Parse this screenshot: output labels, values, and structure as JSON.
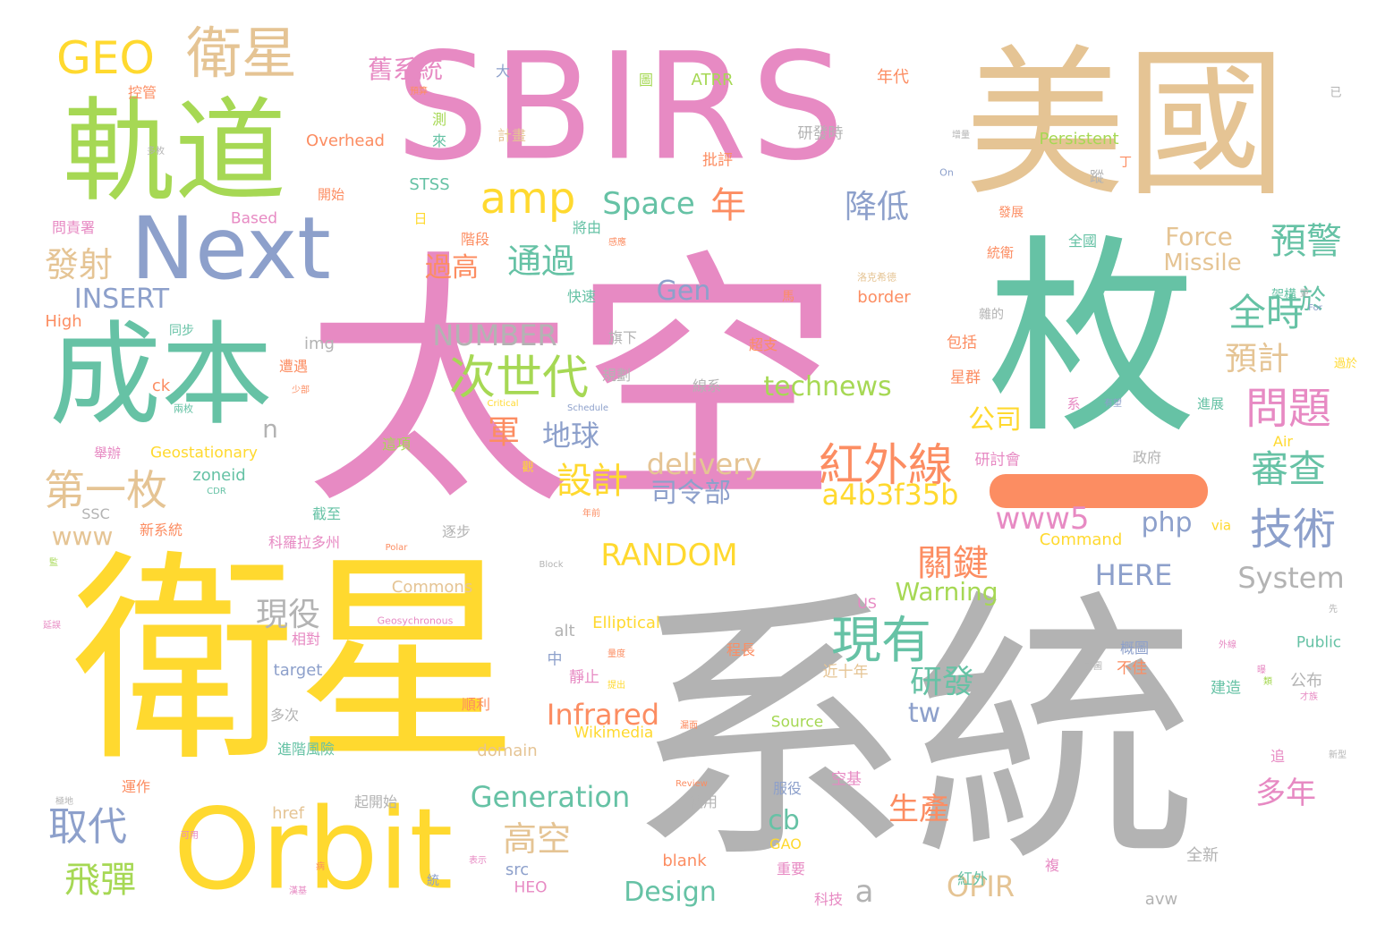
{
  "palette": {
    "pink": "#e78ac3",
    "grey": "#b3b3b3",
    "yellow": "#ffd92f",
    "green": "#a6d854",
    "teal": "#66c2a5",
    "tan": "#e5c494",
    "blue": "#8da0cb",
    "orange": "#fc8d62"
  },
  "words": [
    {
      "text": "太空",
      "color": "pink"
    },
    {
      "text": "系統",
      "color": "grey"
    },
    {
      "text": "衛星",
      "color": "yellow"
    },
    {
      "text": "SBIRS",
      "color": "pink"
    },
    {
      "text": "美國",
      "color": "tan"
    },
    {
      "text": "枚",
      "color": "teal"
    },
    {
      "text": "軌道",
      "color": "green"
    },
    {
      "text": "成本",
      "color": "teal"
    },
    {
      "text": "Orbit",
      "color": "yellow"
    },
    {
      "text": "Next",
      "color": "blue"
    },
    {
      "text": "衛星",
      "color": "tan"
    },
    {
      "text": "GEO",
      "color": "yellow"
    },
    {
      "text": "amp",
      "color": "yellow"
    },
    {
      "text": "現有",
      "color": "teal"
    },
    {
      "text": "紅外線",
      "color": "orange"
    },
    {
      "text": "次世代",
      "color": "green"
    },
    {
      "text": "技術",
      "color": "blue"
    },
    {
      "text": "第一枚",
      "color": "tan"
    },
    {
      "text": "問題",
      "color": "pink"
    },
    {
      "text": "取代",
      "color": "blue"
    },
    {
      "text": "預警",
      "color": "teal"
    },
    {
      "text": "審查",
      "color": "teal"
    },
    {
      "text": "全時",
      "color": "teal"
    },
    {
      "text": "設計",
      "color": "yellow"
    },
    {
      "text": "降低",
      "color": "blue"
    },
    {
      "text": "通過",
      "color": "teal"
    },
    {
      "text": "發射",
      "color": "tan"
    },
    {
      "text": "Space",
      "color": "teal"
    },
    {
      "text": "Force",
      "color": "tan"
    },
    {
      "text": "Missile",
      "color": "tan"
    },
    {
      "text": "INSERT",
      "color": "blue"
    },
    {
      "text": "NUMBER",
      "color": "grey"
    },
    {
      "text": "technews",
      "color": "green"
    },
    {
      "text": "delivery",
      "color": "tan"
    },
    {
      "text": "a4b3f35b",
      "color": "yellow"
    },
    {
      "text": "www5",
      "color": "pink"
    },
    {
      "text": "RANDOM",
      "color": "yellow"
    },
    {
      "text": "關鍵",
      "color": "orange"
    },
    {
      "text": "System",
      "color": "grey"
    },
    {
      "text": "HERE",
      "color": "blue"
    },
    {
      "text": "Warning",
      "color": "green"
    },
    {
      "text": "Infrared",
      "color": "orange"
    },
    {
      "text": "Generation",
      "color": "teal"
    },
    {
      "text": "高空",
      "color": "tan"
    },
    {
      "text": "飛彈",
      "color": "green"
    },
    {
      "text": "Design",
      "color": "teal"
    },
    {
      "text": "OPIR",
      "color": "tan"
    },
    {
      "text": "研發",
      "color": "teal"
    },
    {
      "text": "現役",
      "color": "grey"
    },
    {
      "text": "生產",
      "color": "orange"
    },
    {
      "text": "多年",
      "color": "pink"
    },
    {
      "text": "預計",
      "color": "tan"
    },
    {
      "text": "舊系統",
      "color": "pink"
    },
    {
      "text": "Gen",
      "color": "blue"
    },
    {
      "text": "軍",
      "color": "orange"
    },
    {
      "text": "年",
      "color": "orange"
    },
    {
      "text": "地球",
      "color": "blue"
    },
    {
      "text": "司令部",
      "color": "blue"
    },
    {
      "text": "過高",
      "color": "orange"
    },
    {
      "text": "公司",
      "color": "yellow"
    },
    {
      "text": "php",
      "color": "blue"
    },
    {
      "text": "www",
      "color": "tan"
    },
    {
      "text": "tw",
      "color": "blue"
    },
    {
      "text": "cb",
      "color": "teal"
    },
    {
      "text": "a",
      "color": "grey"
    },
    {
      "text": "n",
      "color": "grey"
    },
    {
      "text": "於",
      "color": "teal"
    },
    {
      "text": "Overhead",
      "color": "orange"
    },
    {
      "text": "Persistent",
      "color": "green"
    },
    {
      "text": "ATRR",
      "color": "green"
    },
    {
      "text": "STSS",
      "color": "teal"
    },
    {
      "text": "Based",
      "color": "pink"
    },
    {
      "text": "border",
      "color": "orange"
    },
    {
      "text": "img",
      "color": "grey"
    },
    {
      "text": "High",
      "color": "orange"
    },
    {
      "text": "ck",
      "color": "orange"
    },
    {
      "text": "zoneid",
      "color": "teal"
    },
    {
      "text": "Geostationary",
      "color": "yellow"
    },
    {
      "text": "SSC",
      "color": "grey"
    },
    {
      "text": "Command",
      "color": "yellow"
    },
    {
      "text": "Commons",
      "color": "tan"
    },
    {
      "text": "Elliptical",
      "color": "yellow"
    },
    {
      "text": "alt",
      "color": "grey"
    },
    {
      "text": "target",
      "color": "blue"
    },
    {
      "text": "domain",
      "color": "tan"
    },
    {
      "text": "Wikimedia",
      "color": "yellow"
    },
    {
      "text": "Source",
      "color": "green"
    },
    {
      "text": "href",
      "color": "tan"
    },
    {
      "text": "src",
      "color": "blue"
    },
    {
      "text": "HEO",
      "color": "pink"
    },
    {
      "text": "blank",
      "color": "orange"
    },
    {
      "text": "GAO",
      "color": "yellow"
    },
    {
      "text": "avw",
      "color": "grey"
    },
    {
      "text": "Public",
      "color": "teal"
    },
    {
      "text": "US",
      "color": "pink"
    },
    {
      "text": "Air",
      "color": "yellow"
    },
    {
      "text": "via",
      "color": "yellow"
    },
    {
      "text": "研發時",
      "color": "grey"
    },
    {
      "text": "計畫",
      "color": "tan"
    },
    {
      "text": "批評",
      "color": "orange"
    },
    {
      "text": "年代",
      "color": "orange"
    },
    {
      "text": "控管",
      "color": "orange"
    },
    {
      "text": "研討會",
      "color": "pink"
    },
    {
      "text": "政府",
      "color": "grey"
    },
    {
      "text": "紅外",
      "color": "teal"
    },
    {
      "text": "全新",
      "color": "grey"
    },
    {
      "text": "近十年",
      "color": "tan"
    },
    {
      "text": "建造",
      "color": "teal"
    },
    {
      "text": "公布",
      "color": "grey"
    },
    {
      "text": "不佳",
      "color": "orange"
    },
    {
      "text": "程長",
      "color": "orange"
    },
    {
      "text": "靜止",
      "color": "pink"
    },
    {
      "text": "中",
      "color": "blue"
    },
    {
      "text": "順利",
      "color": "orange"
    },
    {
      "text": "多次",
      "color": "grey"
    },
    {
      "text": "相對",
      "color": "pink"
    },
    {
      "text": "進階風險",
      "color": "teal"
    },
    {
      "text": "運作",
      "color": "orange"
    },
    {
      "text": "起開始",
      "color": "grey"
    },
    {
      "text": "使用",
      "color": "grey"
    },
    {
      "text": "服役",
      "color": "blue"
    },
    {
      "text": "空基",
      "color": "pink"
    },
    {
      "text": "重要",
      "color": "pink"
    },
    {
      "text": "科技",
      "color": "pink"
    },
    {
      "text": "截至",
      "color": "teal"
    },
    {
      "text": "逐步",
      "color": "grey"
    },
    {
      "text": "新系統",
      "color": "orange"
    },
    {
      "text": "科羅拉多州",
      "color": "pink"
    },
    {
      "text": "這項",
      "color": "green"
    },
    {
      "text": "星群",
      "color": "orange"
    },
    {
      "text": "包括",
      "color": "orange"
    },
    {
      "text": "超支",
      "color": "orange"
    },
    {
      "text": "雜的",
      "color": "grey"
    },
    {
      "text": "旗下",
      "color": "grey"
    },
    {
      "text": "規劃",
      "color": "grey"
    },
    {
      "text": "線系",
      "color": "grey"
    },
    {
      "text": "快速",
      "color": "teal"
    },
    {
      "text": "將由",
      "color": "teal"
    },
    {
      "text": "階段",
      "color": "orange"
    },
    {
      "text": "開始",
      "color": "orange"
    },
    {
      "text": "同步",
      "color": "teal"
    },
    {
      "text": "遭遇",
      "color": "orange"
    },
    {
      "text": "問責署",
      "color": "pink"
    },
    {
      "text": "全國",
      "color": "teal"
    },
    {
      "text": "發展",
      "color": "orange"
    },
    {
      "text": "統衛",
      "color": "orange"
    },
    {
      "text": "進展",
      "color": "teal"
    },
    {
      "text": "架構",
      "color": "teal"
    },
    {
      "text": "過於",
      "color": "yellow"
    },
    {
      "text": "概圖",
      "color": "blue"
    },
    {
      "text": "追",
      "color": "pink"
    },
    {
      "text": "複",
      "color": "pink"
    },
    {
      "text": "統",
      "color": "blue"
    },
    {
      "text": "日",
      "color": "yellow"
    },
    {
      "text": "圖",
      "color": "green"
    },
    {
      "text": "大",
      "color": "blue"
    },
    {
      "text": "來",
      "color": "teal"
    },
    {
      "text": "測",
      "color": "green"
    },
    {
      "text": "蹤",
      "color": "grey"
    },
    {
      "text": "丁",
      "color": "orange"
    },
    {
      "text": "系",
      "color": "pink"
    },
    {
      "text": "馬",
      "color": "orange"
    },
    {
      "text": "已",
      "color": "grey"
    },
    {
      "text": "On",
      "color": "blue"
    },
    {
      "text": "Critical",
      "color": "yellow"
    },
    {
      "text": "Schedule",
      "color": "blue"
    },
    {
      "text": "Polar",
      "color": "orange"
    },
    {
      "text": "Block",
      "color": "grey"
    },
    {
      "text": "CDR",
      "color": "teal"
    },
    {
      "text": "For",
      "color": "blue"
    },
    {
      "text": "Review",
      "color": "orange"
    },
    {
      "text": "Geosychronous",
      "color": "pink"
    },
    {
      "text": "舉辦",
      "color": "pink"
    },
    {
      "text": "兩枚",
      "color": "teal"
    },
    {
      "text": "少部",
      "color": "orange"
    },
    {
      "text": "多枚",
      "color": "grey"
    },
    {
      "text": "觀",
      "color": "yellow"
    },
    {
      "text": "外線",
      "color": "pink"
    },
    {
      "text": "提出",
      "color": "yellow"
    },
    {
      "text": "年前",
      "color": "orange"
    },
    {
      "text": "表示",
      "color": "pink"
    },
    {
      "text": "病",
      "color": "orange"
    },
    {
      "text": "有望",
      "color": "blue"
    },
    {
      "text": "新型",
      "color": "grey"
    },
    {
      "text": "洛克希德",
      "color": "tan"
    },
    {
      "text": "增量",
      "color": "grey"
    },
    {
      "text": "更",
      "color": "grey"
    },
    {
      "text": "才族",
      "color": "pink"
    },
    {
      "text": "感應",
      "color": "orange"
    },
    {
      "text": "預算",
      "color": "orange"
    },
    {
      "text": "極地",
      "color": "grey"
    },
    {
      "text": "可用",
      "color": "pink"
    },
    {
      "text": "漢基",
      "color": "pink"
    },
    {
      "text": "延誤",
      "color": "pink"
    },
    {
      "text": "漏面",
      "color": "orange"
    },
    {
      "text": "首圖",
      "color": "grey"
    },
    {
      "text": "量度",
      "color": "orange"
    },
    {
      "text": "類",
      "color": "green"
    },
    {
      "text": "先",
      "color": "grey"
    },
    {
      "text": "曝",
      "color": "pink"
    },
    {
      "text": "監",
      "color": "green"
    }
  ]
}
